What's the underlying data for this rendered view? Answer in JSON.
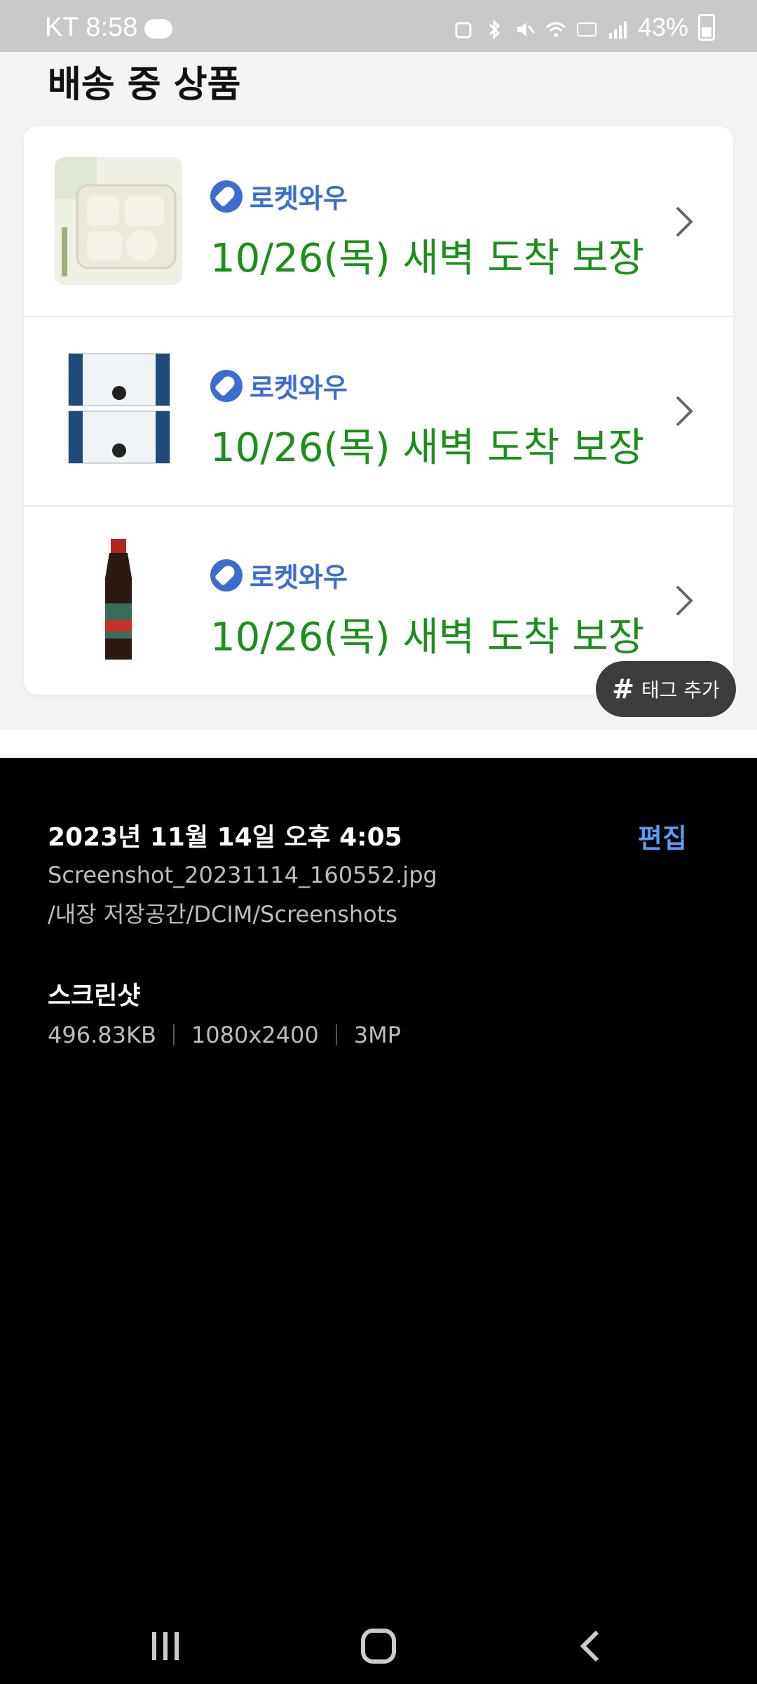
{
  "status_bar": {
    "carrier_time": "KT 8:58",
    "battery_text": "43%"
  },
  "preview": {
    "section_title": "배송 중 상품",
    "items": [
      {
        "service_label": "로켓와우",
        "delivery_text": "10/26(목) 새벽 도착 보장",
        "thumb": "divided-plate-image"
      },
      {
        "service_label": "로켓와우",
        "delivery_text": "10/26(목) 새벽 도착 보장",
        "thumb": "soy-milk-box-image"
      },
      {
        "service_label": "로켓와우",
        "delivery_text": "10/26(목) 새벽 도착 보장",
        "thumb": "sauce-bottle-image"
      }
    ],
    "tag_button": {
      "hash": "#",
      "label": "태그 추가"
    }
  },
  "details": {
    "date": "2023년 11월 14일 오후 4:05",
    "edit_label": "편집",
    "filename": "Screenshot_20231114_160552.jpg",
    "path": "/내장 저장공간/DCIM/Screenshots",
    "category": "스크린샷",
    "size": "496.83KB",
    "resolution": "1080x2400",
    "megapixels": "3MP"
  },
  "colors": {
    "rocket_blue": "#3b6dd1",
    "delivery_green": "#1b8f1b",
    "edit_blue": "#5a9cf7"
  },
  "navbar": {
    "icons": [
      "recent-apps-icon",
      "home-icon",
      "back-icon"
    ]
  }
}
